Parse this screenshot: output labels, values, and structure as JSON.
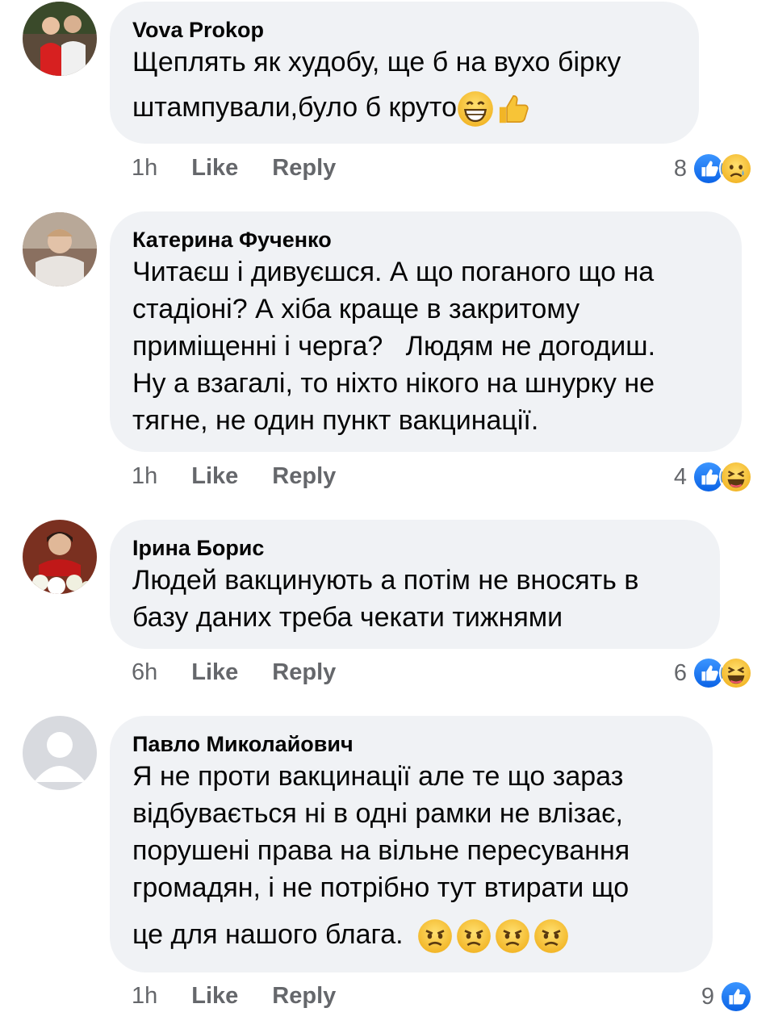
{
  "comments": [
    {
      "author": "Vova Prokop",
      "lines": [
        "Щеплять як худобу, ще б на вухо бірку",
        "штампували,було б круто"
      ],
      "time": "1h",
      "like": "Like",
      "reply": "Reply",
      "reaction_count": "8",
      "reaction_icons": [
        "like-icon",
        "sad-icon"
      ],
      "inline_emoji": [
        "grin-emoji-icon",
        "thumbs-up-emoji-icon"
      ]
    },
    {
      "author": "Катерина Фученко",
      "lines": [
        "Читаєш і дивуєшся. А що поганого що на",
        "стадіоні? А хіба краще в закритому",
        "приміщенні і черга?   Людям не догодиш.",
        "Ну а взагалі, то ніхто нікого на шнурку не",
        "тягне, не один пункт вакцинації."
      ],
      "time": "1h",
      "like": "Like",
      "reply": "Reply",
      "reaction_count": "4",
      "reaction_icons": [
        "like-icon",
        "haha-icon"
      ]
    },
    {
      "author": "Ірина Борис",
      "lines": [
        "Людей вакцинують а потім не вносять в",
        "базу даних треба чекати тижнями"
      ],
      "time": "6h",
      "like": "Like",
      "reply": "Reply",
      "reaction_count": "6",
      "reaction_icons": [
        "like-icon",
        "haha-icon"
      ]
    },
    {
      "author": "Павло Миколайович",
      "lines": [
        "Я не проти вакцинації але те що зараз",
        "відбувається ні в одні рамки не влізає,",
        "порушені права на вільне пересування",
        "громадян, і не потрібно тут втирати що",
        "це для нашого блага."
      ],
      "time": "1h",
      "like": "Like",
      "reply": "Reply",
      "reaction_count": "9",
      "reaction_icons": [
        "like-icon"
      ],
      "inline_emoji": [
        "angry-emoji-icon",
        "angry-emoji-icon",
        "angry-emoji-icon",
        "angry-emoji-icon"
      ]
    }
  ],
  "colors": {
    "bubble": "#f0f2f5",
    "meta": "#65676b",
    "like_blue": "#1877f2",
    "emoji_yellow": "#f7c437"
  }
}
